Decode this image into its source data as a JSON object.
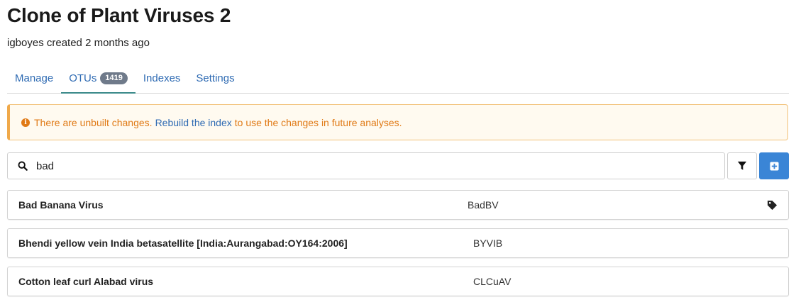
{
  "page": {
    "title": "Clone of Plant Viruses 2",
    "subtitle": "igboyes created 2 months ago"
  },
  "tabs": [
    {
      "label": "Manage"
    },
    {
      "label": "OTUs",
      "badge": "1419",
      "active": true
    },
    {
      "label": "Indexes"
    },
    {
      "label": "Settings"
    }
  ],
  "alert": {
    "text_before": "There are unbuilt changes.",
    "link_text": "Rebuild the index",
    "text_after": "to use the changes in future analyses.",
    "icon": "info-circle-icon",
    "color": "#e07a16"
  },
  "search": {
    "value": "bad",
    "icon": "search-icon"
  },
  "toolbar": {
    "filter_icon": "filter-icon",
    "add_icon": "plus-square-icon",
    "add_color": "#3a85d6"
  },
  "otus": [
    {
      "name": "Bad Banana Virus",
      "abbreviation": "BadBV",
      "has_tag_icon": true
    },
    {
      "name": "Bhendi yellow vein India betasatellite [India:Aurangabad:OY164:2006]",
      "abbreviation": "BYVIB",
      "has_tag_icon": false
    },
    {
      "name": "Cotton leaf curl Alabad virus",
      "abbreviation": "CLCuAV",
      "has_tag_icon": false
    }
  ]
}
